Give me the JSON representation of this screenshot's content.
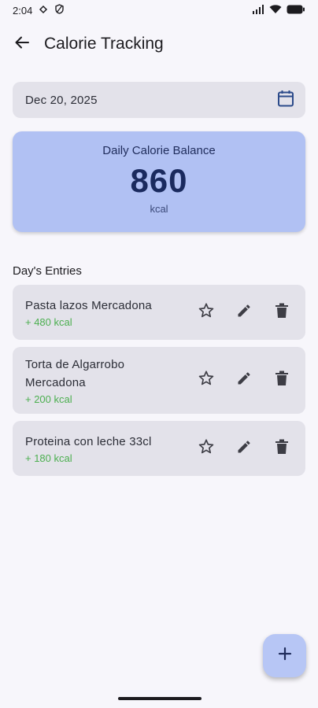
{
  "status_bar": {
    "time": "2:04"
  },
  "app_bar": {
    "title": "Calorie Tracking"
  },
  "date_field": {
    "value": "Dec 20, 2025"
  },
  "balance": {
    "title": "Daily Calorie Balance",
    "value": "860",
    "unit": "kcal"
  },
  "entries_section": {
    "title": "Day's Entries"
  },
  "entries": [
    {
      "name": "Pasta lazos Mercadona",
      "kcal": "+ 480 kcal"
    },
    {
      "name_line1": "Torta de Algarrobo",
      "name_line2": "Mercadona",
      "kcal": "+ 200 kcal"
    },
    {
      "name": "Proteina con leche 33cl",
      "kcal": "+ 180 kcal"
    }
  ],
  "colors": {
    "accent_card": "#b1c1f3",
    "kcal_green": "#4caf50",
    "surface": "#e3e2ea"
  }
}
